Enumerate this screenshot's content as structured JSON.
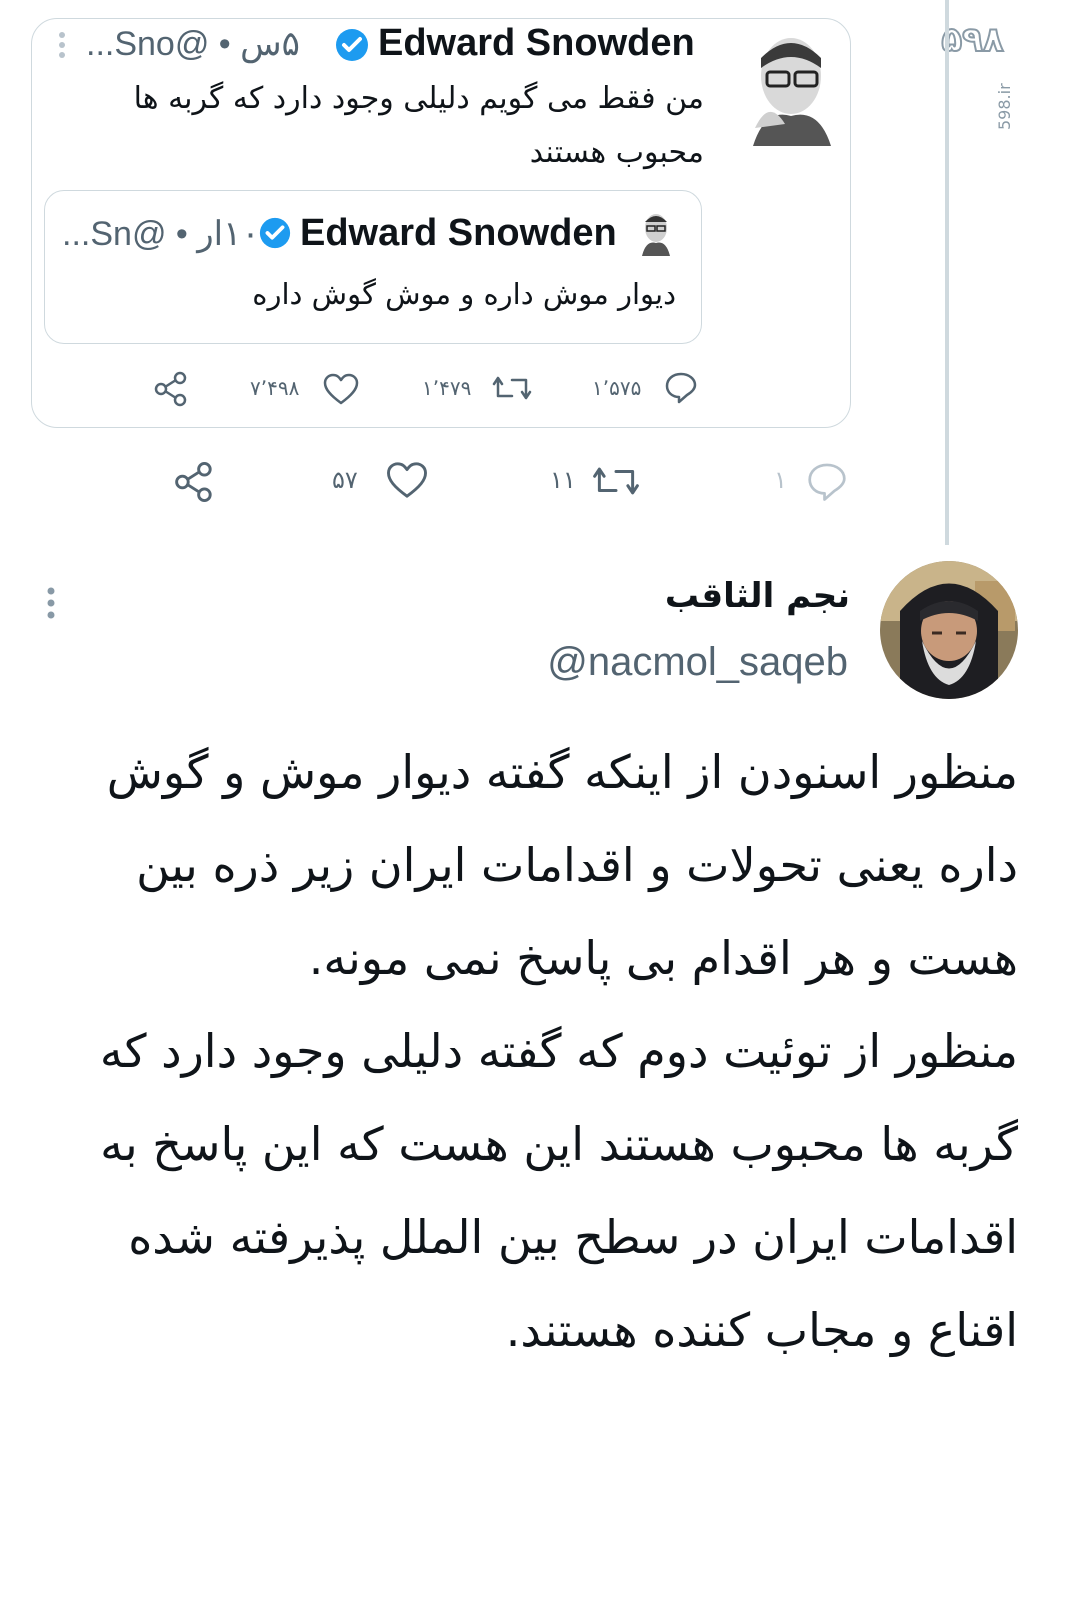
{
  "watermark": {
    "logo": "۵۹۸",
    "site": "598.ir"
  },
  "quoted_tweet": {
    "author_name": "Edward Snowden",
    "handle_time": "۵س • @Sno...",
    "text": "من فقط می گویم دلیلی وجود دارد که گربه ها محبوب هستند",
    "inner_quote": {
      "author_name": "Edward Snowden",
      "handle_time": "۱۰ار • @Sn...",
      "text": "دیوار موش داره و موش گوش داره"
    },
    "actions": {
      "replies": "۱٬۵۷۵",
      "retweets": "۱٬۴۷۹",
      "likes": "۷٬۴۹۸"
    }
  },
  "parent_actions": {
    "replies": "۱",
    "retweets": "۱۱",
    "likes": "۵۷"
  },
  "reply_tweet": {
    "author_name": "نجم الثاقب",
    "handle": "@nacmol_saqeb",
    "text": "منظور اسنودن از اینکه گفته دیوار موش و گوش داره یعنی تحولات و اقدامات ایران زیر ذره بین هست و هر اقدام بی پاسخ نمی مونه.\nمنظور از توئیت دوم که گفته دلیلی وجود دارد که گربه ها محبوب هستند این هست که این پاسخ به اقدامات ایران در سطح بین الملل پذیرفته شده اقناع و مجاب کننده هستند."
  },
  "colors": {
    "verified": "#1d9bf0",
    "border": "#cfd9de",
    "muted": "#536471"
  }
}
